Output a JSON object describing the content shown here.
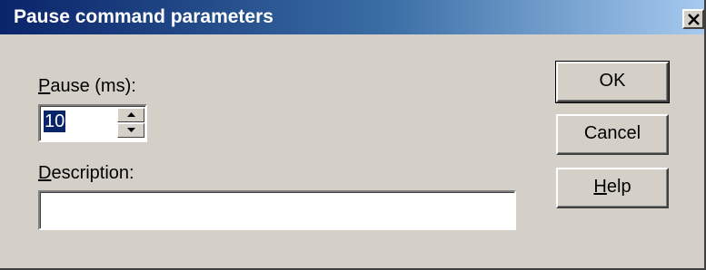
{
  "dialog": {
    "title": "Pause command parameters"
  },
  "fields": {
    "pause": {
      "label_accel": "P",
      "label_rest": "ause (ms):",
      "value": "10"
    },
    "description": {
      "label_accel": "D",
      "label_rest": "escription:",
      "value": ""
    }
  },
  "buttons": {
    "ok": "OK",
    "cancel": "Cancel",
    "help_accel": "H",
    "help_rest": "elp"
  },
  "icons": {
    "close": "close-icon",
    "spin_up": "spin-up-arrow-icon",
    "spin_down": "spin-down-arrow-icon"
  }
}
